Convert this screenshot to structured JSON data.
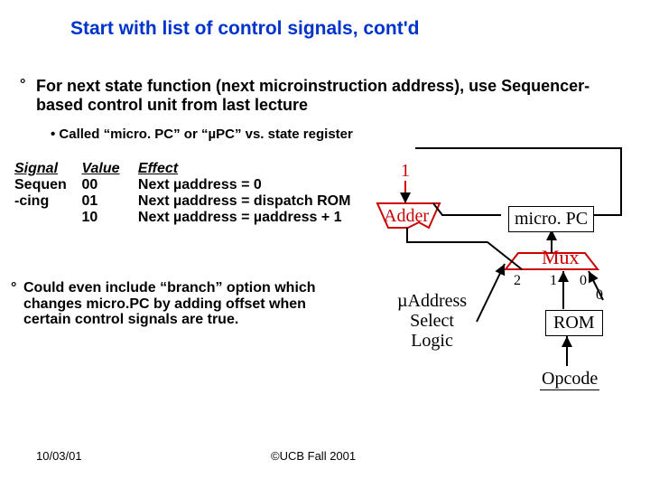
{
  "title": "Start with list of control signals, cont'd",
  "main_point": "For next state function (next microinstruction address), use Sequencer-based control unit from last lecture",
  "sub_point": "Called “micro. PC” or “µPC” vs. state register",
  "table": {
    "headers": {
      "signal": "Signal",
      "value": "Value",
      "effect": "Effect"
    },
    "rows": [
      {
        "signal": "Sequen",
        "value": "00",
        "effect": "Next µaddress = 0"
      },
      {
        "signal": " -cing",
        "value": "01",
        "effect": "Next µaddress = dispatch ROM"
      },
      {
        "signal": "",
        "value": "10",
        "effect": "Next  µaddress =  µaddress + 1"
      }
    ]
  },
  "branch_point": "Could even include “branch” option which changes micro.PC by adding offset when certain control signals are true.",
  "diagram": {
    "one": "1",
    "adder": "Adder",
    "microPC": "micro. PC",
    "mux": "Mux",
    "mux_inputs": {
      "a": "2",
      "b": "1",
      "c": "0",
      "d": "0"
    },
    "uaddr_select": "µAddress\nSelect\nLogic",
    "rom": "ROM",
    "opcode": "Opcode"
  },
  "footer": {
    "left": "10/03/01",
    "center": "©UCB Fall 2001"
  }
}
